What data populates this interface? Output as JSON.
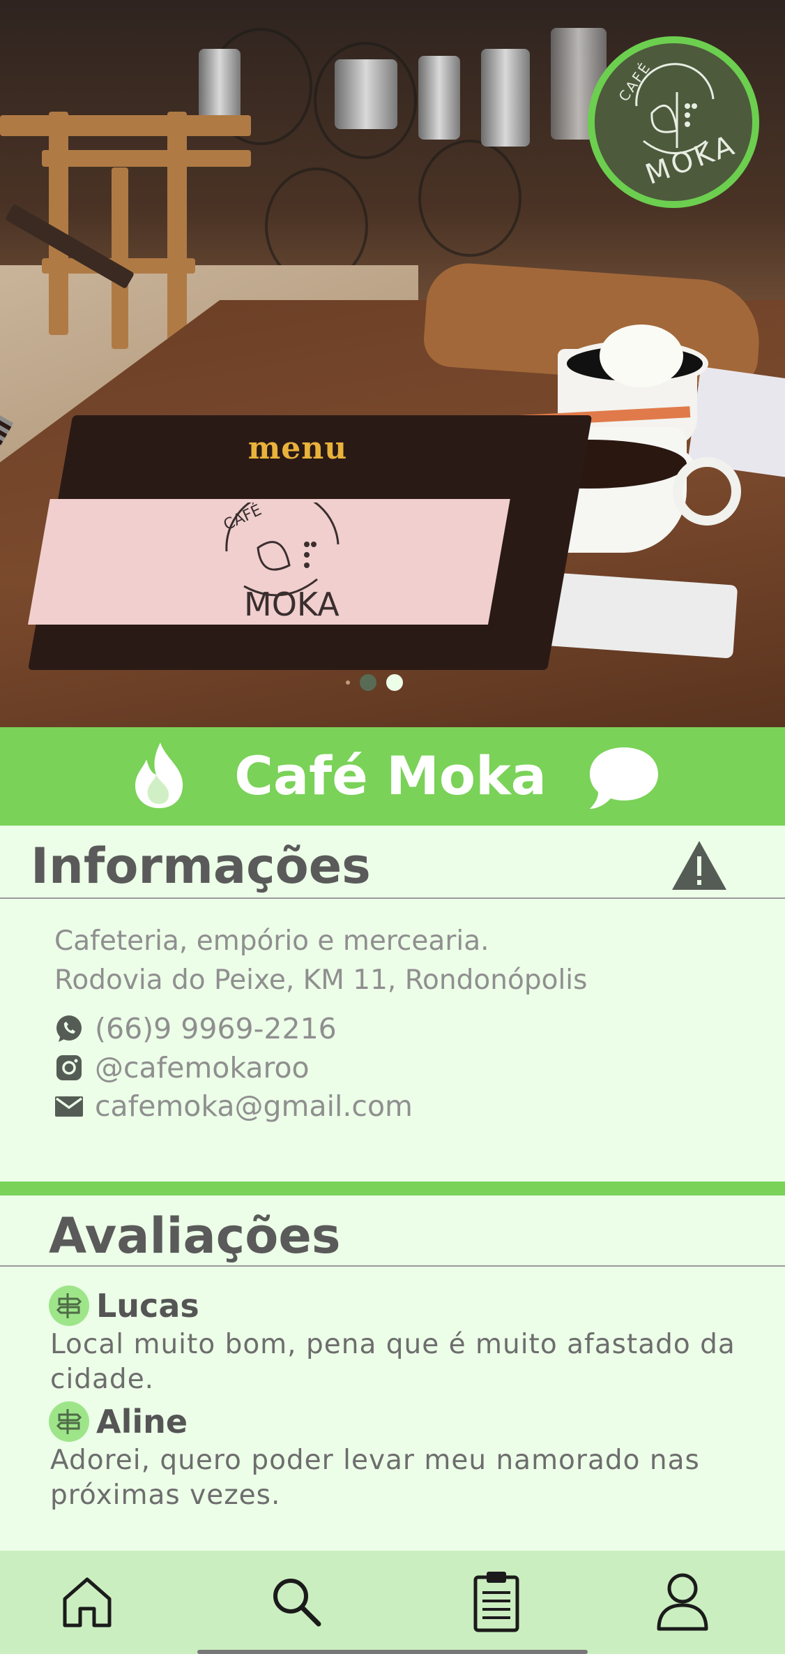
{
  "store": {
    "name": "Café Moka",
    "logo_text_top": "CAFÉ",
    "logo_text_bottom": "MOKA",
    "photo_menu_label": "menu",
    "carousel": {
      "pages": 2,
      "active_index": 1
    }
  },
  "info": {
    "section_title": "Informações",
    "description": "Cafeteria, empório e mercearia.",
    "address": "Rodovia do Peixe, KM 11, Rondonópolis",
    "contacts": [
      {
        "icon": "whatsapp-icon",
        "text": "(66)9 9969-2216"
      },
      {
        "icon": "instagram-icon",
        "text": "@cafemokaroo"
      },
      {
        "icon": "mail-icon",
        "text": "cafemoka@gmail.com"
      }
    ]
  },
  "reviews": {
    "section_title": "Avaliações",
    "items": [
      {
        "name": "Lucas",
        "text": "Local muito bom, pena que é muito afastado da cidade."
      },
      {
        "name": "Aline",
        "text": "Adorei, quero poder levar meu namorado nas próximas vezes."
      }
    ]
  },
  "nav": {
    "items": [
      {
        "icon": "home-icon"
      },
      {
        "icon": "search-icon"
      },
      {
        "icon": "clipboard-icon"
      },
      {
        "icon": "profile-icon"
      }
    ]
  },
  "colors": {
    "accent": "#7ad258",
    "background": "#ecfde8",
    "navbar": "#cbeec0",
    "logo_dark": "#4d5a3c"
  }
}
